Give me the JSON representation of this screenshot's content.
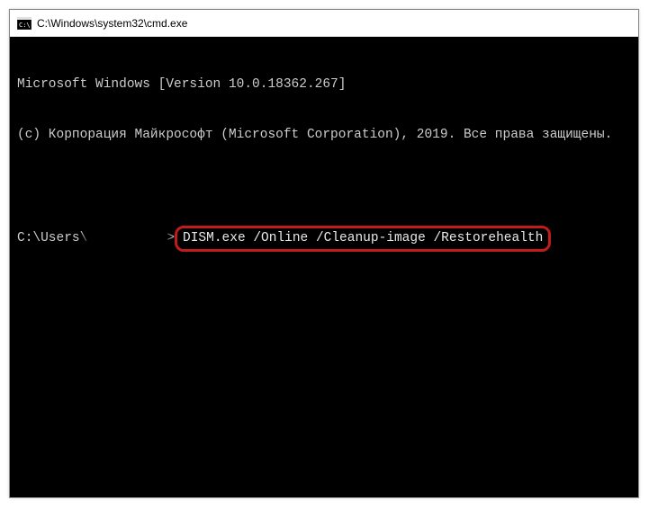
{
  "window": {
    "title": "C:\\Windows\\system32\\cmd.exe"
  },
  "terminal": {
    "line1": "Microsoft Windows [Version 10.0.18362.267]",
    "line2": "(c) Корпорация Майкрософт (Microsoft Corporation), 2019. Все права защищены.",
    "prompt_prefix": "C:\\Users\\",
    "prompt_suffix": ">",
    "command": "DISM.exe /Online /Cleanup-image /Restorehealth"
  }
}
